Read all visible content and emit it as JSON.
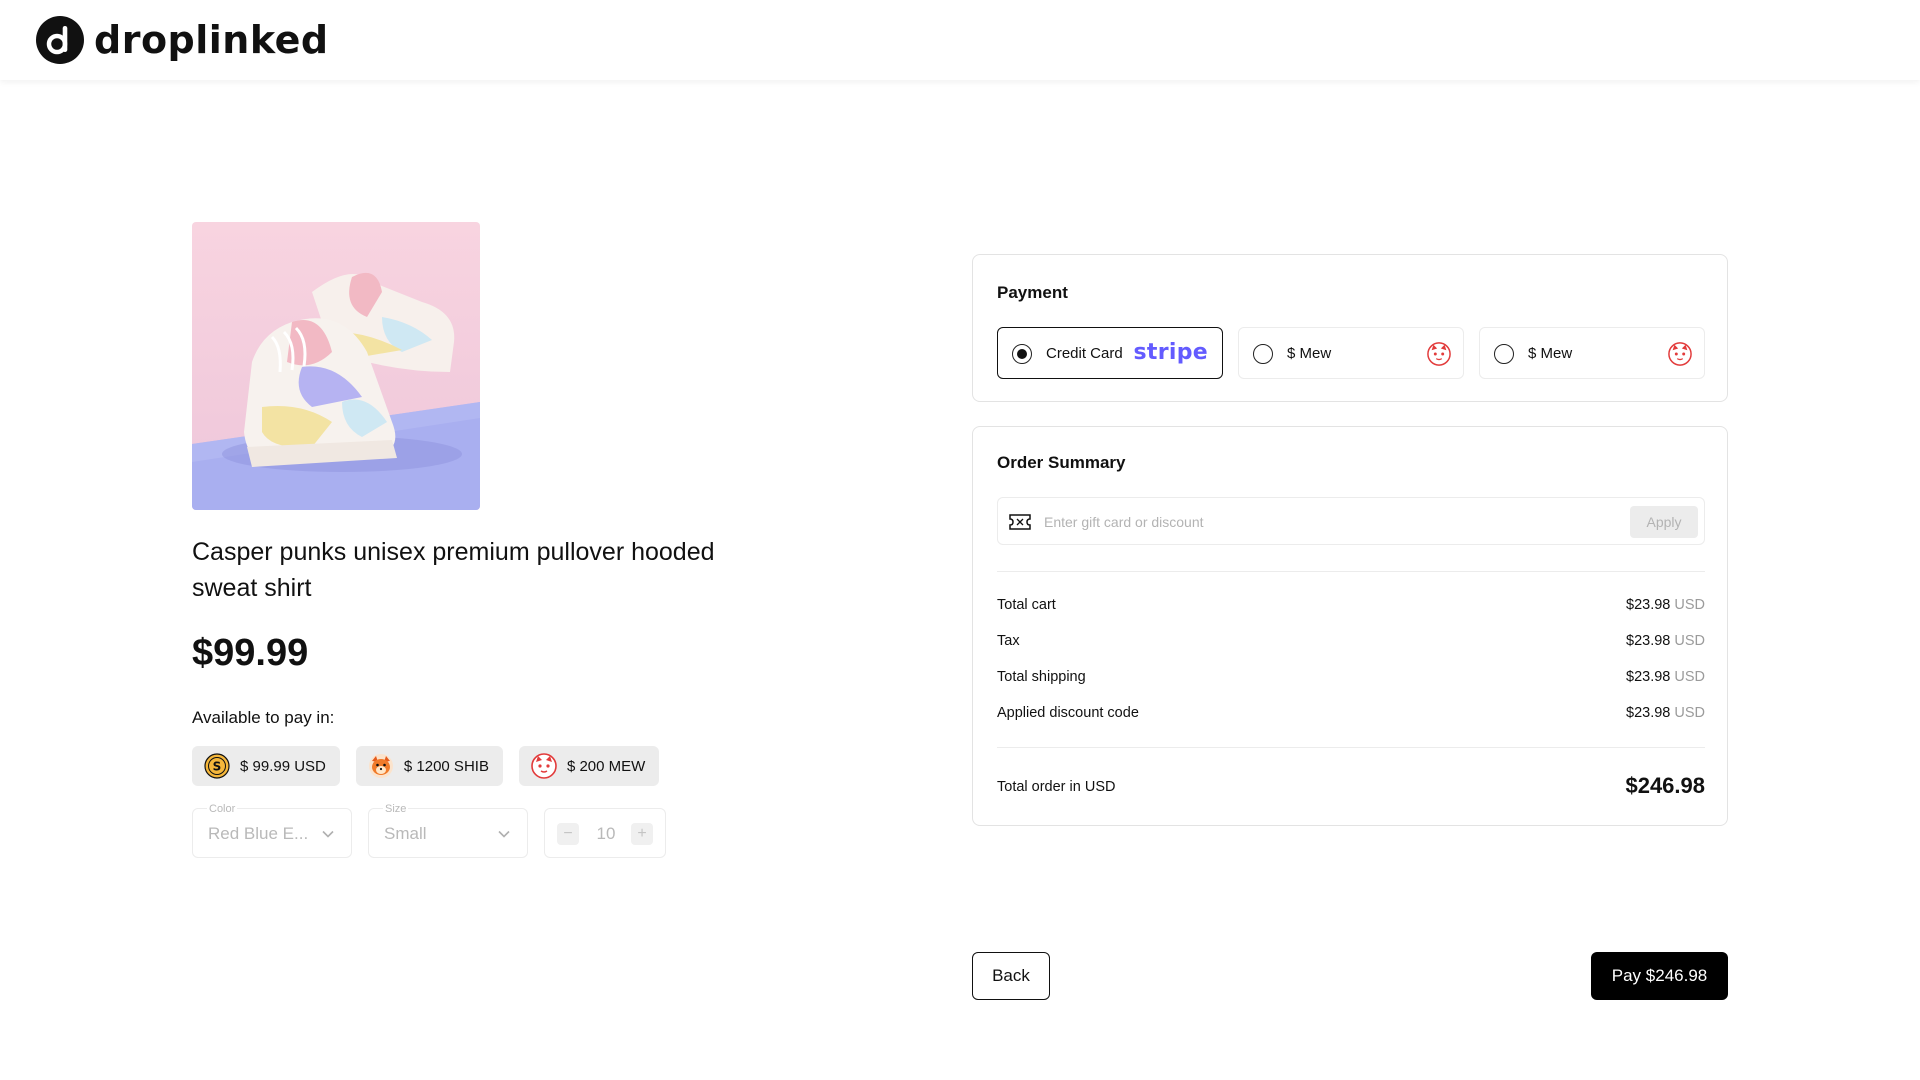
{
  "brand": {
    "name": "droplinked"
  },
  "product": {
    "title": "Casper punks unisex premium pullover hooded sweat shirt",
    "price": "$99.99",
    "pay_in_label": "Available to pay in:",
    "currencies": [
      {
        "label": "$ 99.99 USD",
        "icon": "usd-coin-icon"
      },
      {
        "label": "$ 1200 SHIB",
        "icon": "shib-icon"
      },
      {
        "label": "$ 200 MEW",
        "icon": "mew-icon"
      }
    ],
    "color": {
      "legend": "Color",
      "value": "Red Blue E..."
    },
    "size": {
      "legend": "Size",
      "value": "Small"
    },
    "quantity": {
      "value": "10",
      "minus": "−",
      "plus": "+"
    }
  },
  "payment": {
    "title": "Payment",
    "options": [
      {
        "label": "Credit Card",
        "logo": "stripe",
        "selected": true
      },
      {
        "label": "$ Mew",
        "icon": "mew-icon",
        "selected": false
      },
      {
        "label": "$ Mew",
        "icon": "mew-icon",
        "selected": false
      }
    ]
  },
  "order_summary": {
    "title": "Order Summary",
    "discount_placeholder": "Enter gift card or discount",
    "apply_label": "Apply",
    "rows": [
      {
        "label": "Total cart",
        "amount": "$23.98",
        "currency": "USD"
      },
      {
        "label": "Tax",
        "amount": "$23.98",
        "currency": "USD"
      },
      {
        "label": "Total shipping",
        "amount": "$23.98",
        "currency": "USD"
      },
      {
        "label": "Applied discount code",
        "amount": "$23.98",
        "currency": "USD"
      }
    ],
    "total_label": "Total order in USD",
    "total_value": "$246.98"
  },
  "actions": {
    "back_label": "Back",
    "pay_label": "Pay $246.98"
  },
  "colors": {
    "accent": "#000000",
    "stripe": "#635bff",
    "chip_bg": "#ececec",
    "border": "#e3e3e3"
  }
}
